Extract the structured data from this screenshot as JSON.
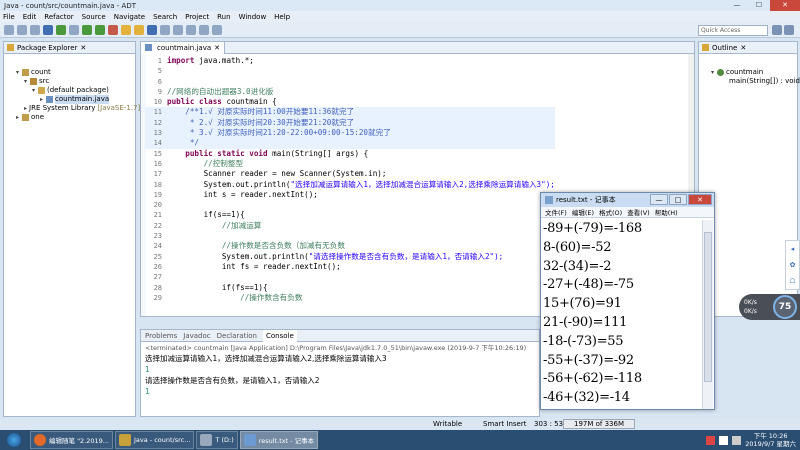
{
  "window": {
    "title": "Java - count/src/countmain.java - ADT",
    "minimize": "—",
    "maximize": "☐",
    "close": "✕"
  },
  "menu": [
    "File",
    "Edit",
    "Refactor",
    "Source",
    "Navigate",
    "Search",
    "Project",
    "Run",
    "Window",
    "Help"
  ],
  "toolbar": {
    "quick_access_placeholder": "Quick Access"
  },
  "package_explorer": {
    "tab_label": "Package Explorer",
    "tab_close": "✕",
    "tree": [
      {
        "label": "count",
        "extra": ""
      },
      {
        "label": "src",
        "extra": ""
      },
      {
        "label": "(default package)",
        "extra": ""
      },
      {
        "label": "countmain.java",
        "extra": ""
      },
      {
        "label": "JRE System Library",
        "extra": "[JavaSE-1.7]"
      },
      {
        "label": "one",
        "extra": ""
      }
    ]
  },
  "editor": {
    "tab_label": "countmain.java",
    "tab_close": "✕",
    "lines": [
      {
        "n": "1",
        "a": "import",
        "b": " java.math.*;",
        "c": ""
      },
      {
        "n": "5",
        "a": "",
        "b": "",
        "c": ""
      },
      {
        "n": "6",
        "a": "",
        "b": "",
        "c": ""
      },
      {
        "n": "9",
        "a": "",
        "b": "//网络的自动出题器3.0进化版",
        "c": ""
      },
      {
        "n": "10",
        "a": "public class",
        "b": " countmain {",
        "c": ""
      },
      {
        "n": "11",
        "a": "",
        "b": "    /**1.√ 对原实际时间11:00开始要11:36就完了",
        "c": ""
      },
      {
        "n": "12",
        "a": "",
        "b": "     * 2.√ 对原实际时间20:30开始要21:20就完了",
        "c": ""
      },
      {
        "n": "13",
        "a": "",
        "b": "     * 3.√ 对原实际时间21:20-22:00+09:00-15:20就完了",
        "c": ""
      },
      {
        "n": "14",
        "a": "",
        "b": "     */",
        "c": ""
      },
      {
        "n": "15",
        "a": "    public static void",
        "b": " main(String[] args) {",
        "c": ""
      },
      {
        "n": "16",
        "a": "",
        "b": "        //控制整型",
        "c": ""
      },
      {
        "n": "17",
        "a": "",
        "b": "        Scanner reader = ",
        "c": "new Scanner(System.in);"
      },
      {
        "n": "18",
        "a": "",
        "b": "        System.out.println(",
        "c": "\"选择加减运算请输入1，选择加减混合运算请输入2,选择乘除运算请输入3\");"
      },
      {
        "n": "19",
        "a": "",
        "b": "        int s = reader.nextInt();",
        "c": ""
      },
      {
        "n": "20",
        "a": "",
        "b": "",
        "c": ""
      },
      {
        "n": "21",
        "a": "",
        "b": "        if(s==1){",
        "c": ""
      },
      {
        "n": "22",
        "a": "",
        "b": "            //加减运算",
        "c": ""
      },
      {
        "n": "23",
        "a": "",
        "b": "",
        "c": ""
      },
      {
        "n": "24",
        "a": "",
        "b": "            //操作数是否含负数（加减有无负数",
        "c": ""
      },
      {
        "n": "25",
        "a": "",
        "b": "            System.out.println(",
        "c": "\"请选择操作数是否含有负数，是请输入1，否请输入2\");"
      },
      {
        "n": "26",
        "a": "",
        "b": "            int fs = reader.nextInt();",
        "c": ""
      },
      {
        "n": "27",
        "a": "",
        "b": "",
        "c": ""
      },
      {
        "n": "28",
        "a": "",
        "b": "            if(fs==1){",
        "c": ""
      },
      {
        "n": "29",
        "a": "",
        "b": "                //操作数含有负数",
        "c": ""
      }
    ]
  },
  "outline": {
    "tab_label": "Outline",
    "tab_close": "✕",
    "class_name": "countmain",
    "method_name": "main(String[]) : void"
  },
  "console": {
    "tabs": [
      "Problems",
      "Javadoc",
      "Declaration",
      "Console"
    ],
    "terminated": "<terminated> countmain [Java Application] D:\\Program Files\\Java\\jdk1.7.0_51\\bin\\javaw.exe (2019-9-7 下午10:26:19)",
    "lines": [
      {
        "text": "选择加减运算请输入1，选择加减混合运算请输入2,选择乘除运算请输入3",
        "input": false
      },
      {
        "text": "1",
        "input": true
      },
      {
        "text": "请选择操作数是否含有负数，是请输入1，否请输入2",
        "input": false
      },
      {
        "text": "1",
        "input": true
      }
    ]
  },
  "statusbar": {
    "writable": "Writable",
    "insert_mode": "Smart Insert",
    "position": "303 : 53",
    "heap": "197M of 336M"
  },
  "notepad": {
    "title": "result.txt - 记事本",
    "minimize": "—",
    "maximize": "□",
    "close": "✕",
    "menu": [
      "文件(F)",
      "编辑(E)",
      "格式(O)",
      "查看(V)",
      "帮助(H)"
    ],
    "lines": [
      "-89+(-79)=-168",
      "8-(60)=-52",
      "32-(34)=-2",
      "-27+(-48)=-75",
      "15+(76)=91",
      "21-(-90)=111",
      "-18-(-73)=55",
      "-55+(-37)=-92",
      "-56+(-62)=-118",
      "-46+(32)=-14"
    ]
  },
  "taskbar": {
    "items": [
      {
        "label": "编辑随笔 \"2.2019...",
        "color": "#e06a2a"
      },
      {
        "label": "Java - count/src...",
        "color": "#c7a23a"
      },
      {
        "label": "T (D:)",
        "color": "#9aa9bb"
      },
      {
        "label": "result.txt - 记事本",
        "color": "#6d9ad0"
      }
    ],
    "time": "下午 10:26",
    "date": "2019/9/7 星期六"
  },
  "widgets": {
    "speed_pct": "75",
    "up_rate": "0K/s",
    "down_rate": "0K/s"
  }
}
